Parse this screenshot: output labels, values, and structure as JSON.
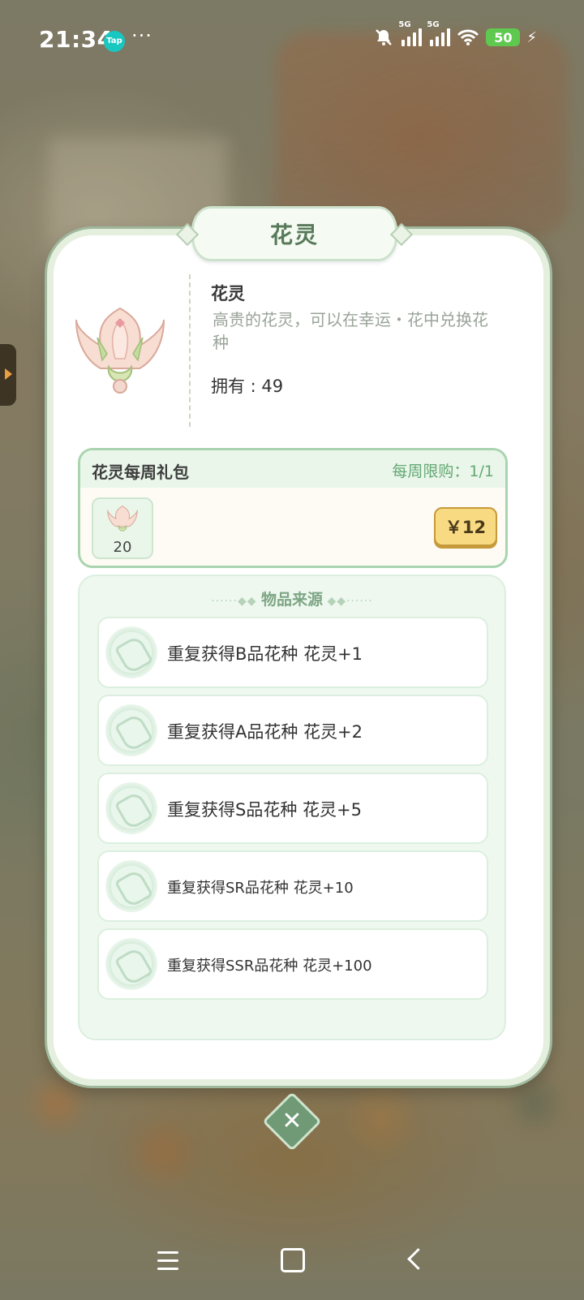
{
  "status_bar": {
    "time": "21:34",
    "app_icon": "Tap",
    "more": "···",
    "network_1": "5G",
    "network_2": "5G",
    "battery": "50"
  },
  "dialog": {
    "title": "花灵",
    "item": {
      "name": "花灵",
      "description": "高贵的花灵，可以在幸运・花中兑换花种",
      "owned": "拥有 : 49"
    },
    "weekly_pack": {
      "title": "花灵每周礼包",
      "limit": "每周限购：1/1",
      "reward_count": "20",
      "price": "￥12"
    },
    "sources": {
      "header": "物品来源",
      "items": [
        {
          "label": "重复获得B品花种 花灵+1"
        },
        {
          "label": "重复获得A品花种 花灵+2"
        },
        {
          "label": "重复获得S品花种 花灵+5"
        },
        {
          "label": "重复获得SR品花种 花灵+10"
        },
        {
          "label": "重复获得SSR品花种 花灵+100"
        }
      ]
    },
    "close_symbol": "✕"
  },
  "colors": {
    "accent_green": "#63a873",
    "price_gold": "#f8da83",
    "battery_green": "#5fc94f"
  },
  "icons": [
    "bell-off-icon",
    "signal-icon",
    "wifi-icon",
    "battery-icon",
    "charging-icon",
    "flower-spirit-icon",
    "scroll-icon",
    "close-icon",
    "menu-icon",
    "home-icon",
    "back-icon"
  ]
}
